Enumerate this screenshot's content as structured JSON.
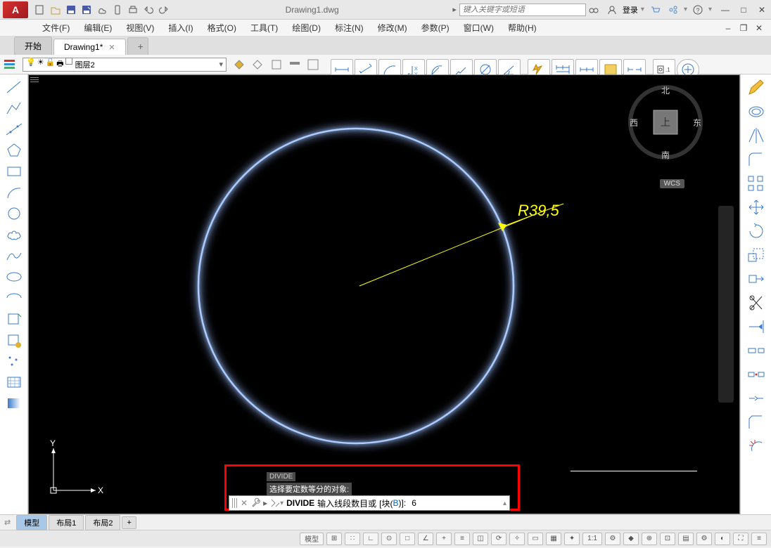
{
  "app": {
    "logo": "A",
    "title": "Drawing1.dwg",
    "search_placeholder": "键入关键字或短语",
    "login": "登录"
  },
  "menus": [
    "文件(F)",
    "编辑(E)",
    "视图(V)",
    "插入(I)",
    "格式(O)",
    "工具(T)",
    "绘图(D)",
    "标注(N)",
    "修改(M)",
    "参数(P)",
    "窗口(W)",
    "帮助(H)"
  ],
  "tabs": {
    "start": "开始",
    "doc": "Drawing1*"
  },
  "layer": {
    "name": "图层2"
  },
  "navcube": {
    "top": "上",
    "n": "北",
    "s": "南",
    "e": "东",
    "w": "西"
  },
  "wcs": "WCS",
  "dimension": "R39,5",
  "cmd": {
    "history_tag": "DIVIDE",
    "history_line": "选择要定数等分的对象:",
    "prompt_cmd": "DIVIDE",
    "prompt_text": "输入线段数目或",
    "prompt_opt_l": "[块(",
    "prompt_opt_key": "B",
    "prompt_opt_r": ")]:",
    "value": "6"
  },
  "bottom_tabs": {
    "model": "模型",
    "layout1": "布局1",
    "layout2": "布局2"
  },
  "ratio": "1:1",
  "ucs": {
    "x": "X",
    "y": "Y"
  }
}
